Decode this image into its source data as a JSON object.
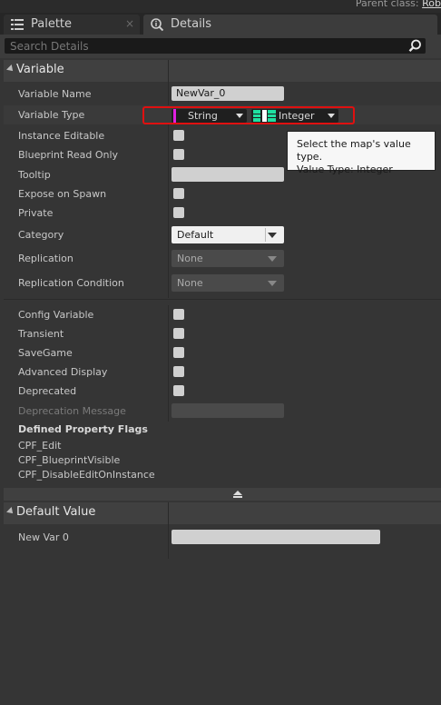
{
  "header": {
    "parent_class_label": "Parent class:",
    "parent_class_value": "Rob"
  },
  "tabs": [
    {
      "label": "Palette",
      "icon": "list-icon",
      "close": "×"
    },
    {
      "label": "Details",
      "icon": "magnifier-info-icon"
    }
  ],
  "search": {
    "placeholder": "Search Details",
    "value": ""
  },
  "variable_section": {
    "title": "Variable",
    "rows": {
      "name": {
        "label": "Variable Name",
        "value": "NewVar_0"
      },
      "type": {
        "label": "Variable Type",
        "key_type": "String",
        "value_type": "Integer"
      },
      "instance_editable": {
        "label": "Instance Editable",
        "checked": false
      },
      "blueprint_read_only": {
        "label": "Blueprint Read Only",
        "checked": false
      },
      "tooltip": {
        "label": "Tooltip",
        "value": ""
      },
      "expose_on_spawn": {
        "label": "Expose on Spawn",
        "checked": false
      },
      "private": {
        "label": "Private",
        "checked": false
      },
      "category": {
        "label": "Category",
        "value": "Default"
      },
      "replication": {
        "label": "Replication",
        "value": "None"
      },
      "replication_condition": {
        "label": "Replication Condition",
        "value": "None"
      }
    }
  },
  "tooltip_popup": {
    "line1": "Select the map's value type.",
    "line2": "Value Type: Integer"
  },
  "advanced_section": {
    "config_variable": {
      "label": "Config Variable",
      "checked": false
    },
    "transient": {
      "label": "Transient",
      "checked": false
    },
    "savegame": {
      "label": "SaveGame",
      "checked": false
    },
    "advanced_display": {
      "label": "Advanced Display",
      "checked": false
    },
    "deprecated": {
      "label": "Deprecated",
      "checked": false
    },
    "deprecation_message": {
      "label": "Deprecation Message",
      "value": ""
    },
    "flags_title": "Defined Property Flags",
    "flags": [
      "CPF_Edit",
      "CPF_BlueprintVisible",
      "CPF_DisableEditOnInstance"
    ]
  },
  "default_value_section": {
    "title": "Default Value",
    "new_var": {
      "label": "New Var 0",
      "value": ""
    }
  },
  "colors": {
    "panel_bg": "#353535",
    "highlight_border": "#e01010",
    "string_pin": "#e020e0",
    "integer_pin": "#1fe0a0"
  }
}
